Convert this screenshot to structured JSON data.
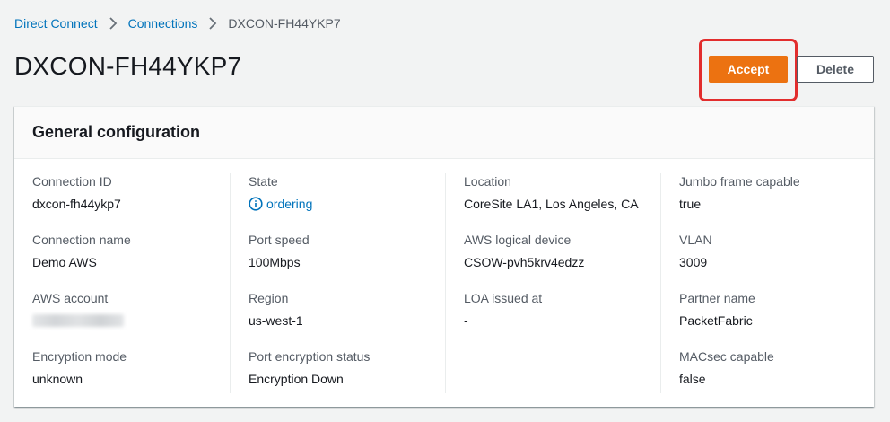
{
  "breadcrumb": {
    "items": [
      "Direct Connect",
      "Connections"
    ],
    "current": "DXCON-FH44YKP7"
  },
  "page": {
    "title": "DXCON-FH44YKP7"
  },
  "actions": {
    "accept_label": "Accept",
    "delete_label": "Delete",
    "accept_color": "#ec7211",
    "highlight_color": "#e22d2d"
  },
  "panel": {
    "title": "General configuration",
    "columns": [
      [
        {
          "label": "Connection ID",
          "value": "dxcon-fh44ykp7"
        },
        {
          "label": "Connection name",
          "value": "Demo AWS"
        },
        {
          "label": "AWS account",
          "value": ""
        },
        {
          "label": "Encryption mode",
          "value": "unknown"
        }
      ],
      [
        {
          "label": "State",
          "value": "ordering"
        },
        {
          "label": "Port speed",
          "value": "100Mbps"
        },
        {
          "label": "Region",
          "value": "us-west-1"
        },
        {
          "label": "Port encryption status",
          "value": "Encryption Down"
        }
      ],
      [
        {
          "label": "Location",
          "value": "CoreSite LA1, Los Angeles, CA"
        },
        {
          "label": "AWS logical device",
          "value": "CSOW-pvh5krv4edzz"
        },
        {
          "label": "LOA issued at",
          "value": "-"
        }
      ],
      [
        {
          "label": "Jumbo frame capable",
          "value": "true"
        },
        {
          "label": "VLAN",
          "value": "3009"
        },
        {
          "label": "Partner name",
          "value": "PacketFabric"
        },
        {
          "label": "MACsec capable",
          "value": "false"
        }
      ]
    ],
    "state_icon": "info-circle-icon"
  }
}
